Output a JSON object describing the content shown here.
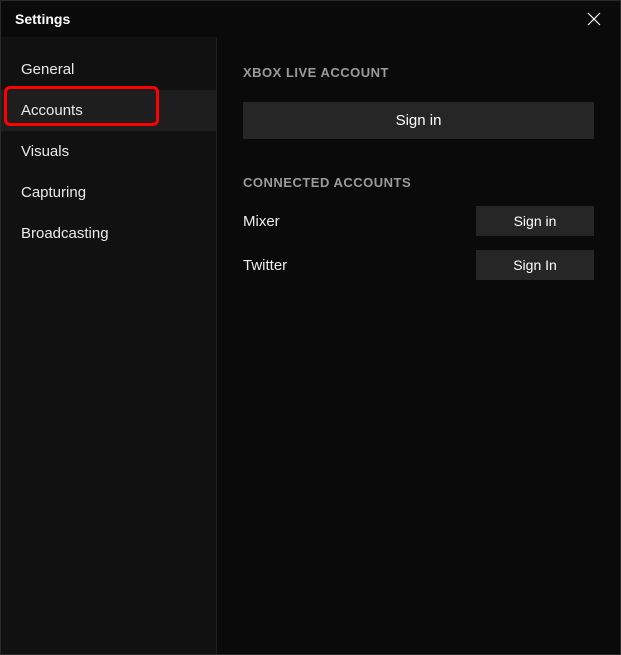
{
  "titlebar": {
    "title": "Settings"
  },
  "sidebar": {
    "items": [
      {
        "label": "General",
        "active": false
      },
      {
        "label": "Accounts",
        "active": true
      },
      {
        "label": "Visuals",
        "active": false
      },
      {
        "label": "Capturing",
        "active": false
      },
      {
        "label": "Broadcasting",
        "active": false
      }
    ]
  },
  "main": {
    "xbox": {
      "header": "XBOX LIVE ACCOUNT",
      "signin_label": "Sign in"
    },
    "connected": {
      "header": "CONNECTED ACCOUNTS",
      "rows": [
        {
          "label": "Mixer",
          "button": "Sign in"
        },
        {
          "label": "Twitter",
          "button": "Sign In"
        }
      ]
    }
  },
  "annotations": {
    "highlight_target": "sidebar-item-accounts",
    "arrow_target": "xbox-signin-button"
  }
}
